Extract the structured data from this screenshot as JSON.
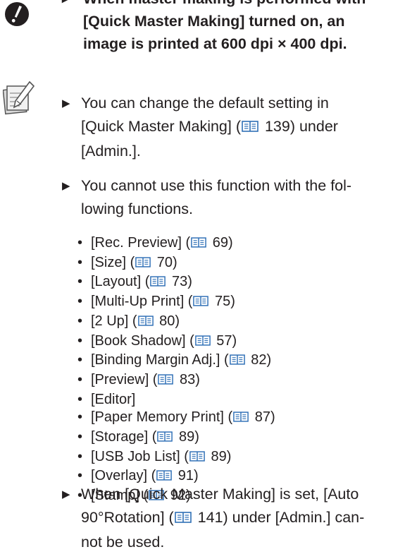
{
  "warning": {
    "icon": "warning-exclamation-icon",
    "lines": [
      "When master making is performed with",
      "[Quick Master Making] turned on, an",
      "image is printed at 600 dpi × 400 dpi."
    ]
  },
  "memo_icon": "memo-pencil-icon",
  "notes": {
    "n1": {
      "l1": "You can change the default setting in",
      "l2a": "[Quick Master Making] (",
      "l2b": " 139) under",
      "l3": "[Admin.]."
    },
    "n2": {
      "l1": "You cannot use this function with the fol-",
      "l2": "lowing functions."
    },
    "n3": {
      "l1": "When [Quick Master Making] is set, [Auto",
      "l2a": "90°Rotation] (",
      "l2b": " 141) under [Admin.] can-",
      "l3": "not be used."
    }
  },
  "bullets": [
    {
      "label": "[Rec. Preview] (",
      "page": " 69)"
    },
    {
      "label": "[Size] (",
      "page": " 70)"
    },
    {
      "label": "[Layout] (",
      "page": " 73)"
    },
    {
      "label": "[Multi-Up Print] (",
      "page": " 75)"
    },
    {
      "label": "[2 Up] (",
      "page": " 80)"
    },
    {
      "label": "[Book Shadow] (",
      "page": " 57)"
    },
    {
      "label": "[Binding Margin Adj.] (",
      "page": " 82)"
    },
    {
      "label": "[Preview] (",
      "page": " 83)"
    },
    {
      "label": "[Editor]",
      "page": ""
    },
    {
      "label": "[Paper Memory Print] (",
      "page": " 87)"
    },
    {
      "label": "[Storage] (",
      "page": " 89)"
    },
    {
      "label": "[USB Job List] (",
      "page": " 89)"
    },
    {
      "label": "[Overlay] (",
      "page": " 91)"
    },
    {
      "label": "[Stamp] (",
      "page": " 92)"
    }
  ],
  "colors": {
    "text": "#231f20",
    "link_icon": "#2f6fb6"
  }
}
